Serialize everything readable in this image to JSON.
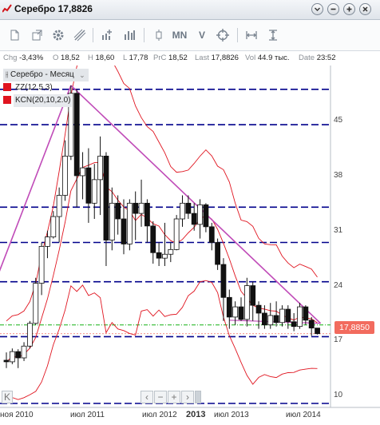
{
  "window": {
    "title": "Серебро 17,8826",
    "buttons": [
      "chevron-down",
      "plus",
      "minus",
      "close"
    ]
  },
  "toolbar": {
    "icons": [
      "page-icon",
      "new-window-icon",
      "gear-icon",
      "draw-icon",
      "add-indicator-icon",
      "bar-chart-icon",
      "candle-icon",
      "zigzag-icon",
      "v-icon",
      "crosshair-icon",
      "zoom-horizontal-icon",
      "zoom-vertical-icon"
    ],
    "mn_label": "MN",
    "v_label": "V"
  },
  "stats": {
    "chg_label": "Chg",
    "chg": "-3,43%",
    "o_label": "O",
    "o": "18,52",
    "h_label": "H",
    "h": "18,60",
    "l_label": "L",
    "l": "17,78",
    "prc_label": "PrC",
    "prc": "18,52",
    "last_label": "Last",
    "last": "17,8826",
    "vol_label": "Vol",
    "vol": "44.9 тыс.",
    "date_label": "Date",
    "date": "23:52"
  },
  "legend": {
    "instrument": "Серебро - Месяц",
    "indicators": [
      "ZZ(12,5,3)",
      "KCN(20,10,2.0)"
    ]
  },
  "price_tag": "17,8850",
  "colors": {
    "bull": "#ffffff",
    "bear": "#111111",
    "indicator": "#e0141f",
    "trendline": "#c04bb8",
    "level": "#00008b",
    "support_green": "#12b012",
    "price_tag": "#f26b5e"
  },
  "chart_data": {
    "type": "candlestick",
    "yticks": [
      45,
      38,
      31,
      24,
      17,
      10
    ],
    "xticks": [
      "ноя 2010",
      "июл 2011",
      "июл 2012",
      "2013",
      "июл 2013",
      "июл 2014"
    ],
    "ylim": [
      9,
      50
    ],
    "levels": [
      49,
      44.5,
      34,
      29.5,
      24.5,
      17.5,
      9
    ],
    "candles": [
      [
        14.5,
        15.5,
        13.5,
        14.3
      ],
      [
        14.3,
        16,
        14,
        15.6
      ],
      [
        15.6,
        15.9,
        13.5,
        14.8
      ],
      [
        14.8,
        16.8,
        14.4,
        16.3
      ],
      [
        16.3,
        19.5,
        16,
        19.2
      ],
      [
        19.2,
        25,
        19,
        24.3
      ],
      [
        24.3,
        29.5,
        22.8,
        29
      ],
      [
        29,
        31,
        27.5,
        30.2
      ],
      [
        30.2,
        33.5,
        30,
        32.8
      ],
      [
        32.8,
        36.5,
        29.5,
        35.5
      ],
      [
        35.5,
        42.5,
        34.8,
        40.5
      ],
      [
        40.5,
        49.5,
        40,
        48.5
      ],
      [
        48.5,
        49,
        34,
        38
      ],
      [
        38,
        41,
        35,
        39
      ],
      [
        39,
        41.5,
        32,
        34.5
      ],
      [
        34.5,
        39.5,
        32.5,
        37.5
      ],
      [
        37.5,
        43,
        33,
        40.5
      ],
      [
        40.5,
        41,
        26.5,
        29.8
      ],
      [
        29.8,
        36.5,
        28.5,
        34.5
      ],
      [
        34.5,
        35.5,
        30.5,
        32.5
      ],
      [
        32.5,
        35,
        28,
        29.3
      ],
      [
        29.3,
        35,
        28.5,
        34.5
      ],
      [
        34.5,
        36,
        29.8,
        33.2
      ],
      [
        33.2,
        37.5,
        31.5,
        34.5
      ],
      [
        34.5,
        35,
        29.5,
        31.6
      ],
      [
        31.6,
        32.2,
        26.8,
        28.2
      ],
      [
        28.2,
        29.5,
        26.5,
        27.5
      ],
      [
        27.5,
        32,
        26.5,
        28
      ],
      [
        28,
        29.5,
        27,
        28.6
      ],
      [
        28.6,
        33,
        28.5,
        32.5
      ],
      [
        32.5,
        35.5,
        31.5,
        34.5
      ],
      [
        34.5,
        35.5,
        32.5,
        33.2
      ],
      [
        33.2,
        34.5,
        31,
        31.8
      ],
      [
        31.8,
        35,
        30,
        34.3
      ],
      [
        34.3,
        34.5,
        30.8,
        31.5
      ],
      [
        31.5,
        32,
        28.5,
        29.5
      ],
      [
        29.5,
        30,
        26,
        26.7
      ],
      [
        26.7,
        27.5,
        19.5,
        22.5
      ],
      [
        22.5,
        23.5,
        18.5,
        20
      ],
      [
        20,
        22,
        19,
        21.3
      ],
      [
        21.3,
        22.5,
        19.5,
        19.7
      ],
      [
        19.7,
        25,
        18.8,
        24
      ],
      [
        24,
        24.5,
        19.5,
        21.5
      ],
      [
        21.5,
        22,
        18.5,
        20.5
      ],
      [
        20.5,
        21.5,
        18.5,
        19
      ],
      [
        19,
        21.8,
        18.5,
        20.2
      ],
      [
        20.2,
        22,
        18.8,
        19.3
      ],
      [
        19.3,
        21.5,
        18.8,
        21
      ],
      [
        21,
        21.5,
        18.5,
        19.4
      ],
      [
        19.4,
        20.5,
        18.2,
        18.8
      ],
      [
        18.8,
        21.8,
        18.5,
        21.3
      ],
      [
        21.3,
        21.5,
        19,
        19.6
      ],
      [
        19.6,
        20,
        17.6,
        18.6
      ],
      [
        18.6,
        18.6,
        17.78,
        17.88
      ]
    ]
  }
}
